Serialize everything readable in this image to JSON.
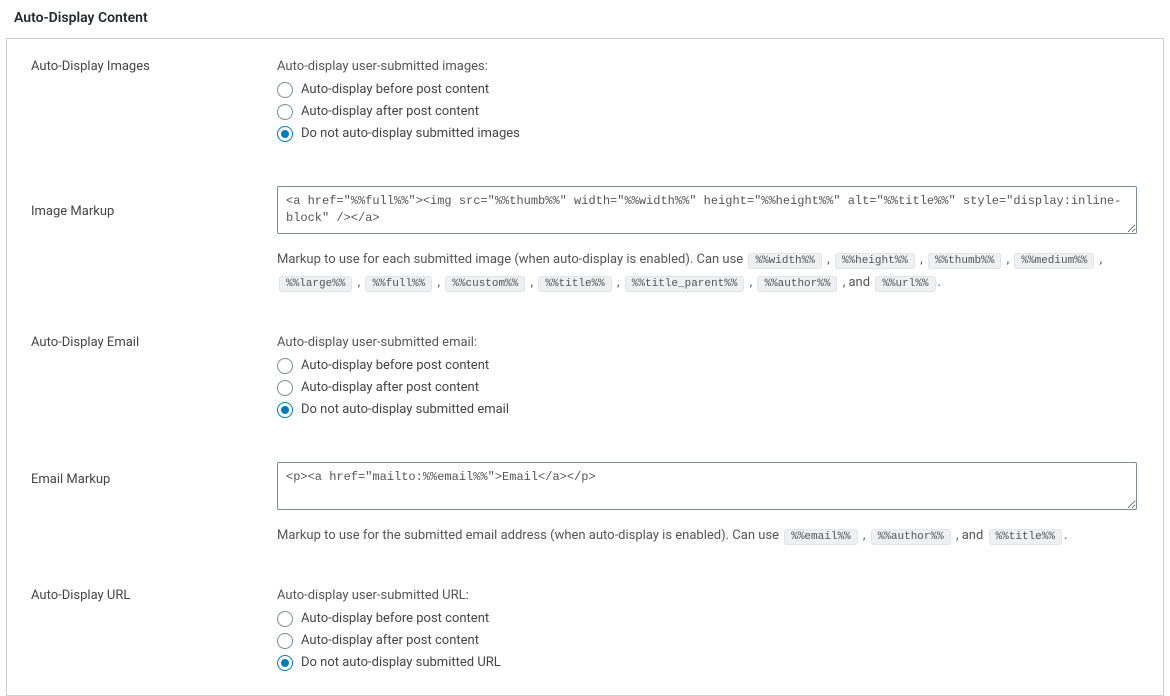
{
  "section_title": "Auto-Display Content",
  "rows": {
    "images": {
      "th": "Auto-Display Images",
      "legend": "Auto-display user-submitted images:",
      "opt_before": "Auto-display before post content",
      "opt_after": "Auto-display after post content",
      "opt_none": "Do not auto-display submitted images"
    },
    "image_markup": {
      "th": "Image Markup",
      "value": "<a href=\"%%full%%\"><img src=\"%%thumb%%\" width=\"%%width%%\" height=\"%%height%%\" alt=\"%%title%%\" style=\"display:inline-block\" /></a>",
      "desc_prefix": "Markup to use for each submitted image (when auto-display is enabled). Can use",
      "tokens": [
        "%%width%%",
        "%%height%%",
        "%%thumb%%",
        "%%medium%%",
        "%%large%%",
        "%%full%%",
        "%%custom%%",
        "%%title%%",
        "%%title_parent%%",
        "%%author%%"
      ],
      "and": ", and",
      "last_token": "%%url%%",
      "period": "."
    },
    "email": {
      "th": "Auto-Display Email",
      "legend": "Auto-display user-submitted email:",
      "opt_before": "Auto-display before post content",
      "opt_after": "Auto-display after post content",
      "opt_none": "Do not auto-display submitted email"
    },
    "email_markup": {
      "th": "Email Markup",
      "value": "<p><a href=\"mailto:%%email%%\">Email</a></p>",
      "desc_prefix": "Markup to use for the submitted email address (when auto-display is enabled). Can use",
      "tokens": [
        "%%email%%",
        "%%author%%"
      ],
      "and": ", and",
      "last_token": "%%title%%",
      "period": "."
    },
    "url": {
      "th": "Auto-Display URL",
      "legend": "Auto-display user-submitted URL:",
      "opt_before": "Auto-display before post content",
      "opt_after": "Auto-display after post content",
      "opt_none": "Do not auto-display submitted URL"
    }
  }
}
